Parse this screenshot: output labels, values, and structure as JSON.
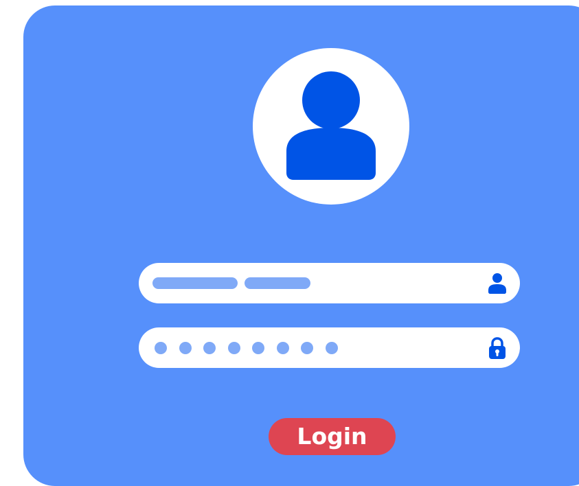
{
  "form": {
    "login_label": "Login"
  },
  "username_field": {
    "icon": "user-icon"
  },
  "password_field": {
    "icon": "lock-icon",
    "masked_char_count": 8
  },
  "avatar": {
    "icon": "user-avatar-icon"
  },
  "colors": {
    "card_background": "#5690fb",
    "avatar_icon": "#0054e6",
    "placeholder_bars": "#7fa9f7",
    "login_button": "#de4552",
    "field_background": "#ffffff"
  }
}
